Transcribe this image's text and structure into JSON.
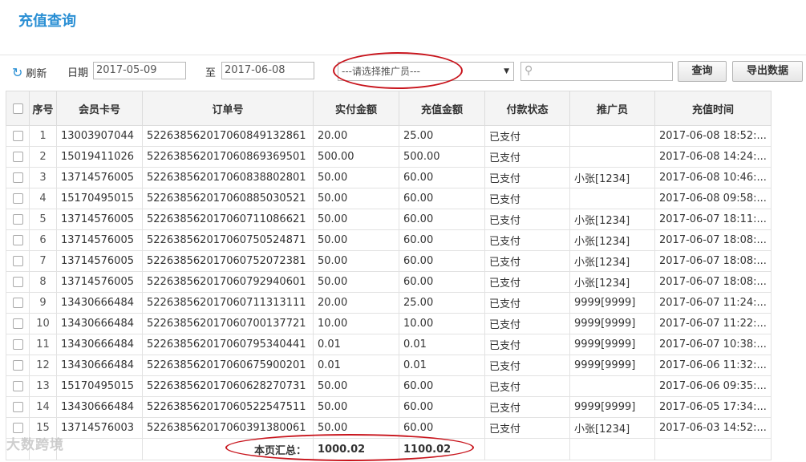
{
  "page": {
    "title": "充值查询"
  },
  "toolbar": {
    "refresh_label": "刷新",
    "date_label": "日期",
    "date_from": "2017-05-09",
    "to_label": "至",
    "date_to": "2017-06-08",
    "promoter_select": "---请选择推广员---",
    "search_value": "",
    "query_label": "查询",
    "export_label": "导出数据"
  },
  "table": {
    "headers": [
      "序号",
      "会员卡号",
      "订单号",
      "实付金额",
      "充值金额",
      "付款状态",
      "推广员",
      "充值时间"
    ],
    "rows": [
      [
        "1",
        "13003907044",
        "522638562017060849132861",
        "20.00",
        "25.00",
        "已支付",
        "",
        "2017-06-08 18:52:..."
      ],
      [
        "2",
        "15019411026",
        "522638562017060869369501",
        "500.00",
        "500.00",
        "已支付",
        "",
        "2017-06-08 14:24:..."
      ],
      [
        "3",
        "13714576005",
        "522638562017060838802801",
        "50.00",
        "60.00",
        "已支付",
        "小张[1234]",
        "2017-06-08 10:46:..."
      ],
      [
        "4",
        "15170495015",
        "522638562017060885030521",
        "50.00",
        "60.00",
        "已支付",
        "",
        "2017-06-08 09:58:..."
      ],
      [
        "5",
        "13714576005",
        "522638562017060711086621",
        "50.00",
        "60.00",
        "已支付",
        "小张[1234]",
        "2017-06-07 18:11:..."
      ],
      [
        "6",
        "13714576005",
        "522638562017060750524871",
        "50.00",
        "60.00",
        "已支付",
        "小张[1234]",
        "2017-06-07 18:08:..."
      ],
      [
        "7",
        "13714576005",
        "522638562017060752072381",
        "50.00",
        "60.00",
        "已支付",
        "小张[1234]",
        "2017-06-07 18:08:..."
      ],
      [
        "8",
        "13714576005",
        "522638562017060792940601",
        "50.00",
        "60.00",
        "已支付",
        "小张[1234]",
        "2017-06-07 18:08:..."
      ],
      [
        "9",
        "13430666484",
        "522638562017060711313111",
        "20.00",
        "25.00",
        "已支付",
        "9999[9999]",
        "2017-06-07 11:24:..."
      ],
      [
        "10",
        "13430666484",
        "522638562017060700137721",
        "10.00",
        "10.00",
        "已支付",
        "9999[9999]",
        "2017-06-07 11:22:..."
      ],
      [
        "11",
        "13430666484",
        "522638562017060795340441",
        "0.01",
        "0.01",
        "已支付",
        "9999[9999]",
        "2017-06-07 10:38:..."
      ],
      [
        "12",
        "13430666484",
        "522638562017060675900201",
        "0.01",
        "0.01",
        "已支付",
        "9999[9999]",
        "2017-06-06 11:32:..."
      ],
      [
        "13",
        "15170495015",
        "522638562017060628270731",
        "50.00",
        "60.00",
        "已支付",
        "",
        "2017-06-06 09:35:..."
      ],
      [
        "14",
        "13430666484",
        "522638562017060522547511",
        "50.00",
        "60.00",
        "已支付",
        "9999[9999]",
        "2017-06-05 17:34:..."
      ],
      [
        "15",
        "13714576003",
        "522638562017060391380061",
        "50.00",
        "60.00",
        "已支付",
        "小张[1234]",
        "2017-06-03 14:52:..."
      ]
    ],
    "summary": {
      "label": "本页汇总：",
      "paid_total": "1000.02",
      "recharge_total": "1100.02"
    }
  },
  "watermark": "大数跨境",
  "colors": {
    "accent": "#2a8fd4",
    "annotation": "#c8141c"
  }
}
